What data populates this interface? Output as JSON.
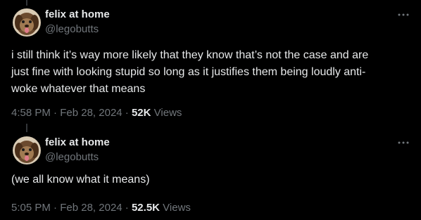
{
  "tweets": [
    {
      "author_name": "felix at home",
      "handle": "@legobutts",
      "text": "i still think it’s way more likely that they know that’s not the case and are\njust fine with looking stupid so long as it justifies them being loudly anti-\nwoke whatever that means",
      "time": "4:58 PM",
      "date": "Feb 28, 2024",
      "views_count": "52K",
      "views_label": "Views",
      "separator": "·"
    },
    {
      "author_name": "felix at home",
      "handle": "@legobutts",
      "text": "(we all know what it means)",
      "time": "5:05 PM",
      "date": "Feb 28, 2024",
      "views_count": "52.5K",
      "views_label": "Views",
      "separator": "·"
    }
  ],
  "icons": {
    "more": "more-horizontal-icon",
    "avatar": "dog-avatar"
  },
  "colors": {
    "background": "#000000",
    "primary_text": "#e7e9ea",
    "secondary_text": "#71767b",
    "thread_line": "#333639"
  }
}
